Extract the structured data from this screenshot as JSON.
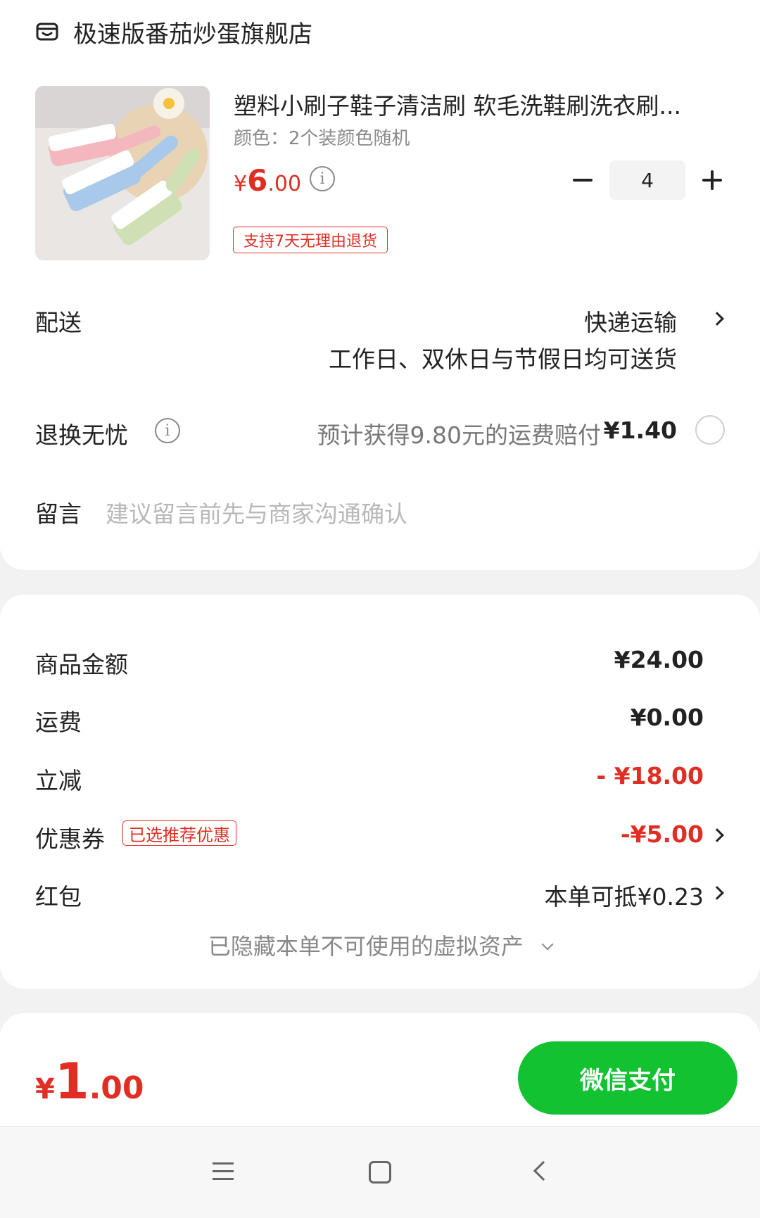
{
  "store": {
    "name": "极速版番茄炒蛋旗舰店",
    "icon": "store-icon"
  },
  "product": {
    "title": "塑料小刷子鞋子清洁刷 软毛洗鞋刷洗衣刷...",
    "spec": "颜色：2个装颜色随机",
    "price_symbol": "¥",
    "price_int": "6",
    "price_dec": ".00",
    "quantity": "4",
    "return_tag": "支持7天无理由退货",
    "image": "product-thumbnail"
  },
  "delivery": {
    "label": "配送",
    "method": "快递运输",
    "note": "工作日、双休日与节假日均可送货"
  },
  "worry_free": {
    "label": "退换无忧",
    "desc": "预计获得9.80元的运费赔付",
    "price": "¥1.40"
  },
  "message": {
    "label": "留言",
    "placeholder": "建议留言前先与商家沟通确认"
  },
  "summary": {
    "goods_label": "商品金额",
    "goods_value": "¥24.00",
    "shipping_label": "运费",
    "shipping_value": "¥0.00",
    "discount_label": "立减",
    "discount_value": "- ¥18.00",
    "coupon_label": "优惠券",
    "coupon_tag": "已选推荐优惠",
    "coupon_value": "-¥5.00",
    "redpacket_label": "红包",
    "redpacket_value": "本单可抵¥0.23",
    "hidden_assets": "已隐藏本单不可使用的虚拟资产"
  },
  "footer": {
    "total_symbol": "¥",
    "total_int": "1",
    "total_dec": ".00",
    "pay_label": "微信支付"
  },
  "colors": {
    "accent_red": "#e02e24",
    "pay_green": "#12c231"
  }
}
